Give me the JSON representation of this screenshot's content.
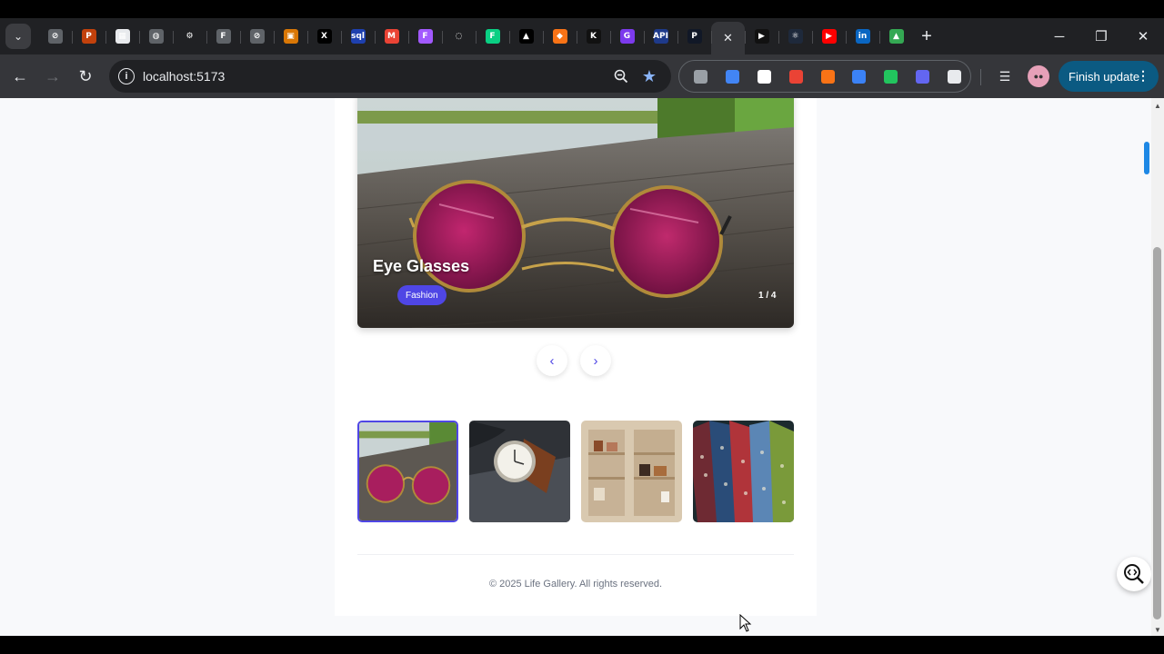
{
  "browser": {
    "tab_list_label": "⌄",
    "tabs": [
      {
        "icon": "tab-link-icon",
        "glyph": "⊘",
        "color": "#5f6368"
      },
      {
        "icon": "tab-p-icon",
        "glyph": "P",
        "color": "#c2410c"
      },
      {
        "icon": "tab-grid-icon",
        "glyph": "▦",
        "color": "#e8eaed"
      },
      {
        "icon": "tab-globe-icon",
        "glyph": "◍",
        "color": "#5f6368"
      },
      {
        "icon": "tab-openai-icon",
        "glyph": "⚙",
        "color": "#202124"
      },
      {
        "icon": "tab-framer-icon",
        "glyph": "F",
        "color": "#5f6368"
      },
      {
        "icon": "tab-disabled-icon",
        "glyph": "⊘",
        "color": "#5f6368"
      },
      {
        "icon": "tab-image-icon",
        "glyph": "▣",
        "color": "#d97706"
      },
      {
        "icon": "tab-x-icon",
        "glyph": "X",
        "color": "#000000"
      },
      {
        "icon": "tab-sql-icon",
        "glyph": "sql",
        "color": "#1e40af"
      },
      {
        "icon": "tab-gmail-icon",
        "glyph": "M",
        "color": "#ea4335"
      },
      {
        "icon": "tab-figma-icon",
        "glyph": "F",
        "color": "#a259ff"
      },
      {
        "icon": "tab-loading-icon",
        "glyph": "◌",
        "color": "#202124"
      },
      {
        "icon": "tab-figma2-icon",
        "glyph": "F",
        "color": "#0acf83"
      },
      {
        "icon": "tab-triangle-icon",
        "glyph": "▲",
        "color": "#000000"
      },
      {
        "icon": "tab-shield-icon",
        "glyph": "◆",
        "color": "#f97316"
      },
      {
        "icon": "tab-k-icon",
        "glyph": "K",
        "color": "#111111"
      },
      {
        "icon": "tab-g-icon",
        "glyph": "G",
        "color": "#7c3aed"
      },
      {
        "icon": "tab-api-icon",
        "glyph": "API",
        "color": "#1e3a8a"
      },
      {
        "icon": "tab-p2-icon",
        "glyph": "P",
        "color": "#111827"
      },
      {
        "icon": "tab-close-icon",
        "glyph": "✕",
        "color": "#35363a",
        "active": true
      },
      {
        "icon": "tab-play-icon",
        "glyph": "▶",
        "color": "#111111"
      },
      {
        "icon": "tab-react-icon",
        "glyph": "⚛",
        "color": "#1e293b"
      },
      {
        "icon": "tab-youtube-icon",
        "glyph": "▶",
        "color": "#ff0000"
      },
      {
        "icon": "tab-linkedin-icon",
        "glyph": "in",
        "color": "#0a66c2"
      },
      {
        "icon": "tab-drive-icon",
        "glyph": "▲",
        "color": "#34a853"
      }
    ],
    "new_tab": "+",
    "minimize": "─",
    "restore": "❐",
    "close": "✕",
    "url": "localhost:5173",
    "finish_update": "Finish update",
    "extensions": [
      {
        "name": "ext-bottle-icon",
        "color": "#9aa0a6"
      },
      {
        "name": "ext-doc-icon",
        "color": "#4285f4"
      },
      {
        "name": "ext-circle-icon",
        "color": "#ffffff"
      },
      {
        "name": "ext-bug-icon",
        "color": "#ea4335"
      },
      {
        "name": "ext-box-icon",
        "color": "#f97316"
      },
      {
        "name": "ext-square-icon",
        "color": "#3b82f6"
      },
      {
        "name": "ext-pen-icon",
        "color": "#22c55e"
      },
      {
        "name": "ext-eye-icon",
        "color": "#6366f1"
      },
      {
        "name": "ext-puzzle-icon",
        "color": "#e8eaed"
      }
    ]
  },
  "gallery": {
    "current_title": "Eye Glasses",
    "current_category": "Fashion",
    "counter": "1 / 4",
    "prev_label": "‹",
    "next_label": "›",
    "thumbnails": [
      {
        "name": "thumbnail-eye-glasses",
        "selected": true
      },
      {
        "name": "thumbnail-watch",
        "selected": false
      },
      {
        "name": "thumbnail-store",
        "selected": false
      },
      {
        "name": "thumbnail-ties",
        "selected": false
      }
    ],
    "footer": "© 2025 Life Gallery. All rights reserved."
  },
  "colors": {
    "accent": "#4f46e5",
    "page_bg": "#f8f9fb",
    "finish_update_bg": "#0b5a82"
  }
}
